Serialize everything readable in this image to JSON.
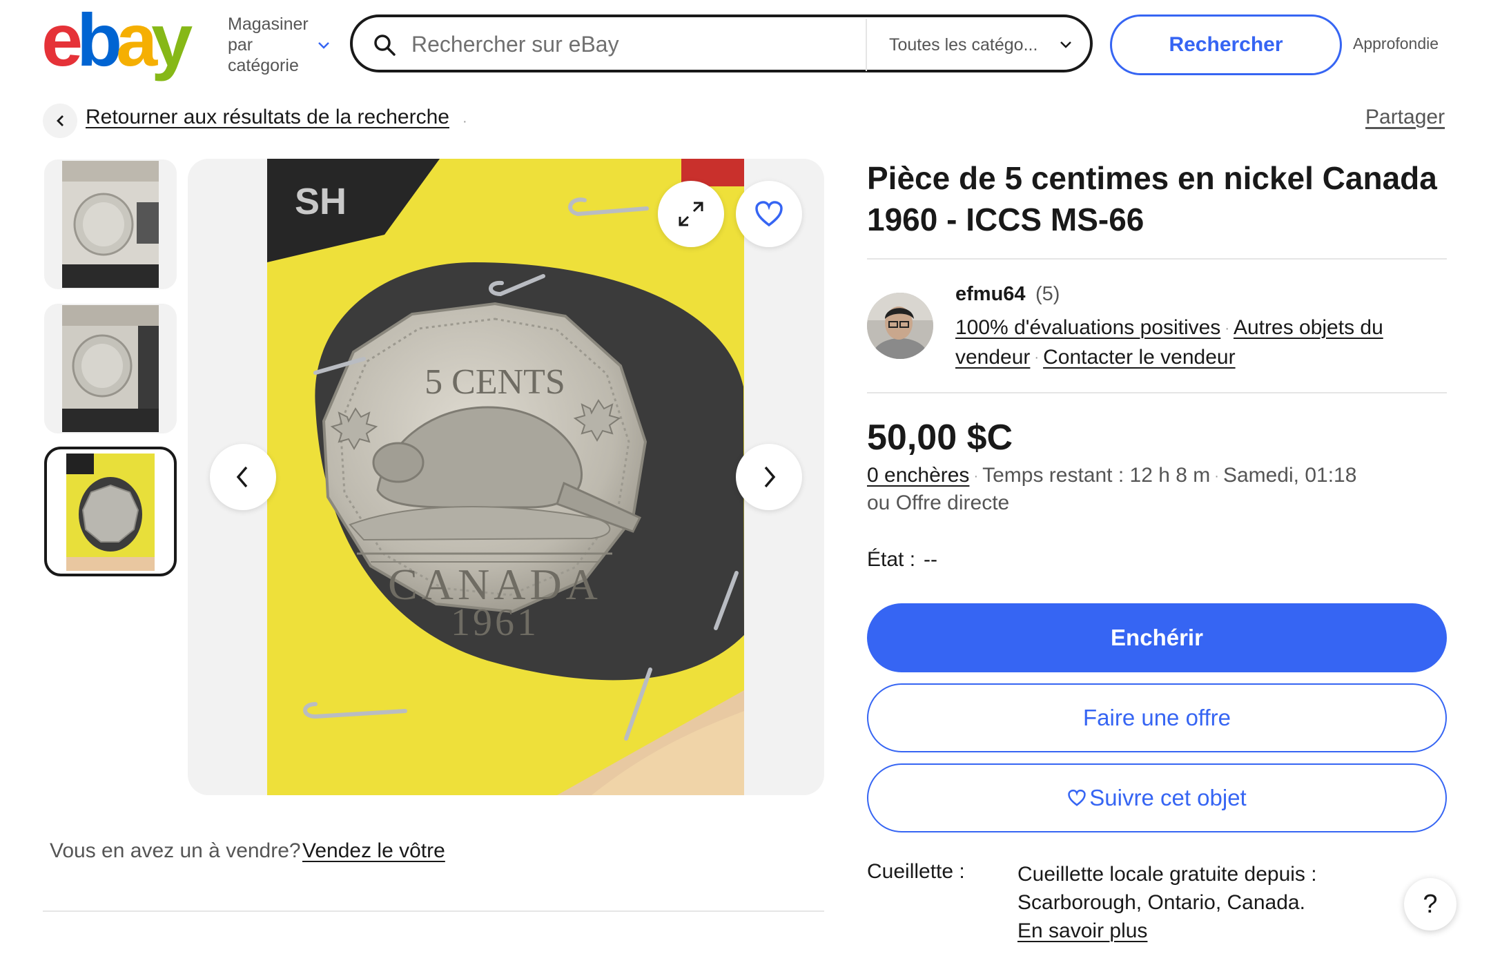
{
  "header": {
    "logo_letters": [
      "e",
      "b",
      "a",
      "y"
    ],
    "logo_colors": [
      "#e53238",
      "#0064d2",
      "#f5af02",
      "#86b817"
    ],
    "shop_by_category": "Magasiner par catégorie",
    "search_placeholder": "Rechercher sur eBay",
    "category_select": "Toutes les catégo...",
    "search_button": "Rechercher",
    "advanced": "Approfondie"
  },
  "nav": {
    "back_link": "Retourner aux résultats de la recherche",
    "separator": "·",
    "share": "Partager"
  },
  "gallery": {
    "thumbnails": [
      "photo-1",
      "photo-2",
      "photo-3"
    ],
    "selected_index": 2,
    "coin_top_text": "5 CENTS",
    "coin_bottom_text": "CANADA",
    "coin_year": "1961"
  },
  "sell": {
    "question": "Vous en avez un à vendre?",
    "link": "Vendez le vôtre"
  },
  "item": {
    "title": "Pièce de 5 centimes en nickel Canada 1960 - ICCS MS-66",
    "seller_name": "efmu64",
    "seller_count": "(5)",
    "feedback": "100% d'évaluations positives",
    "other_items": "Autres objets du vendeur",
    "contact": "Contacter le vendeur",
    "price": "50,00 $C",
    "bids": "0 enchères",
    "time_left": "Temps restant : 12 h 8 m",
    "end_time": "Samedi, 01:18",
    "offer_line": "ou Offre directe",
    "condition_label": "État :",
    "condition_value": "--",
    "bid_button": "Enchérir",
    "offer_button": "Faire une offre",
    "watch_button": "Suivre cet objet",
    "pickup_label": "Cueillette :",
    "pickup_text": "Cueillette locale gratuite depuis : Scarborough, Ontario, Canada.",
    "learn_more": "En savoir plus",
    "help": "?"
  },
  "colors": {
    "accent_blue": "#3665f3",
    "text": "#191919",
    "muted": "#555555",
    "divider": "#e5e5e5",
    "panel_bg": "#f2f2f2"
  }
}
